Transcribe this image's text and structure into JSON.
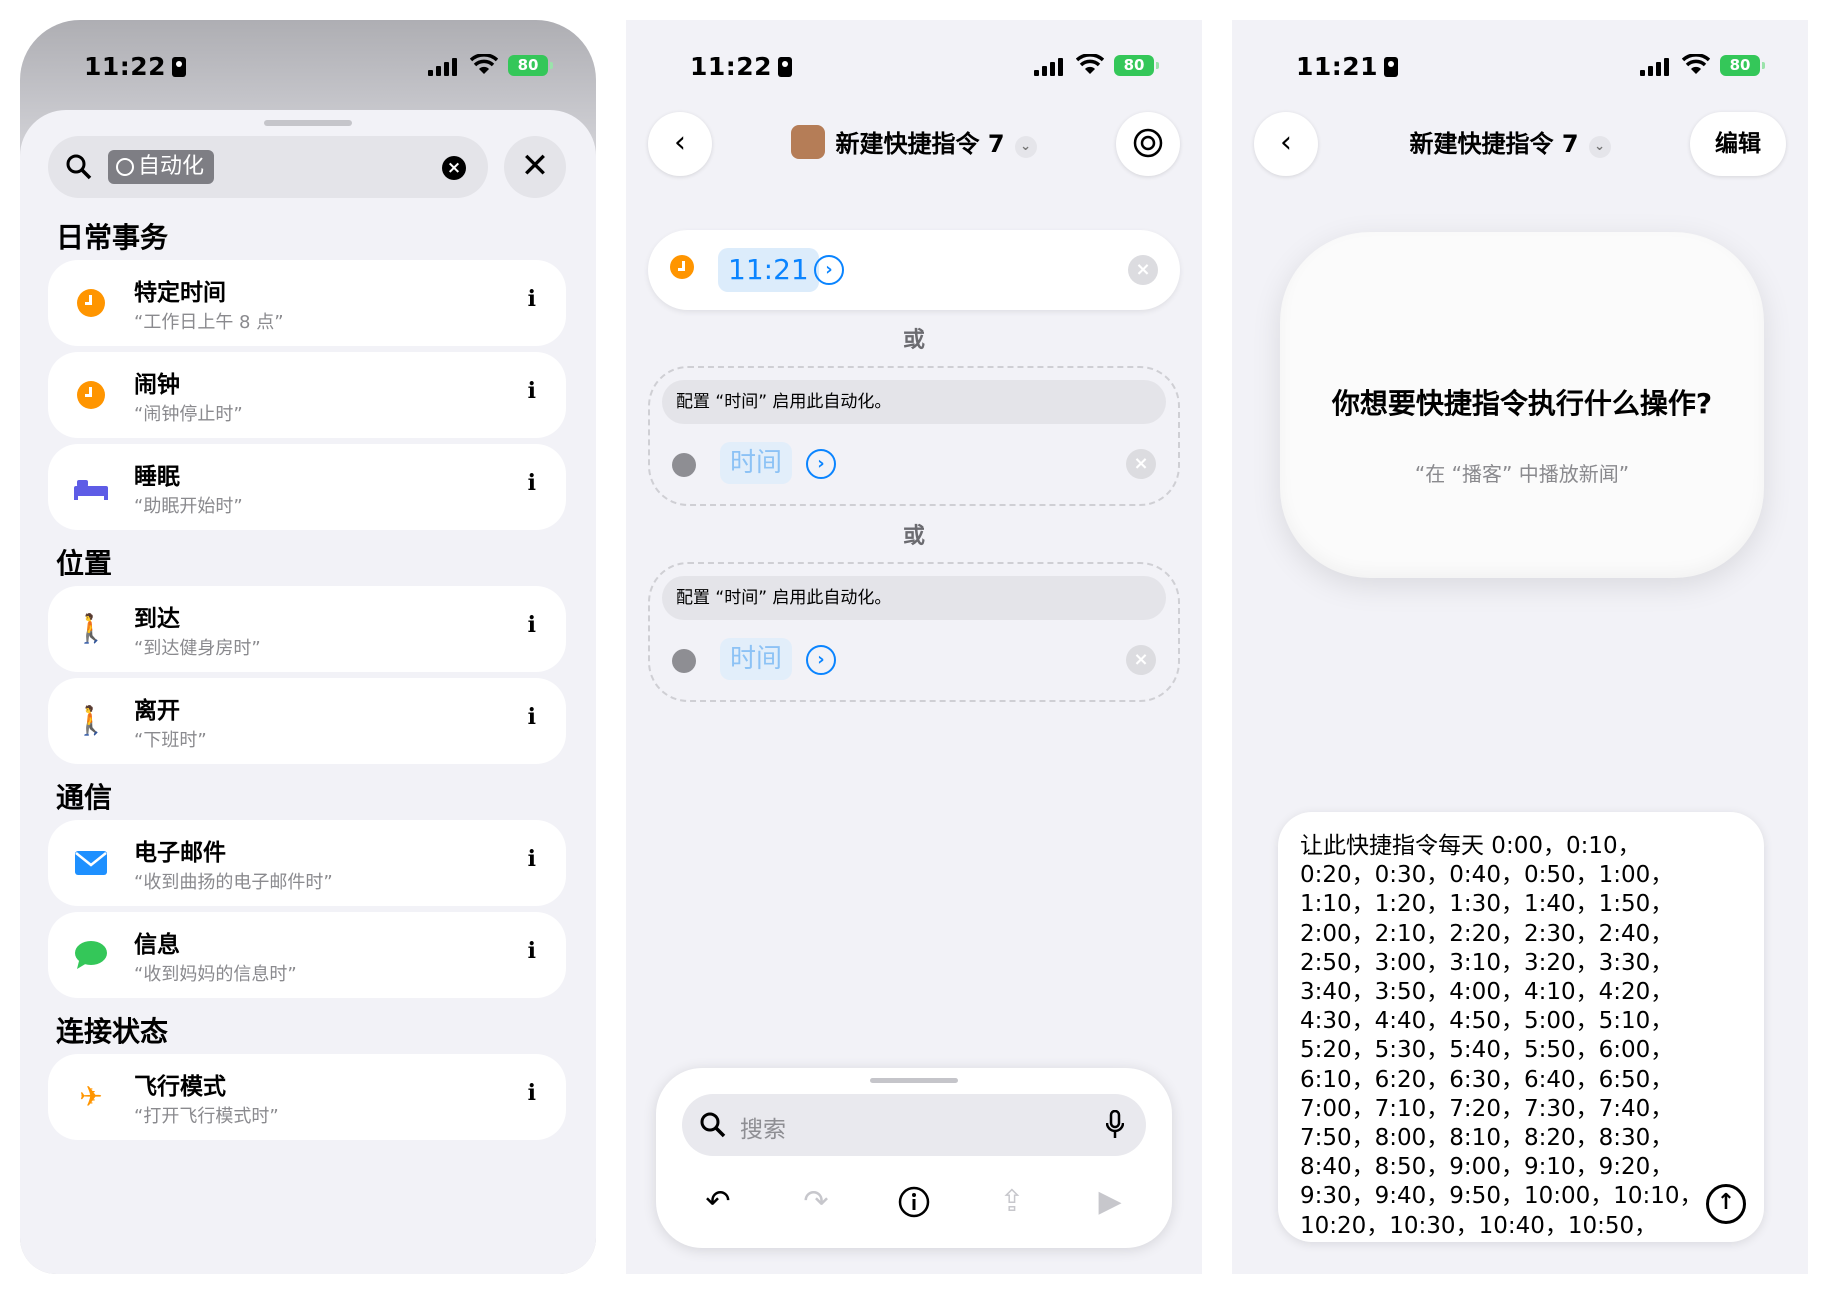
{
  "status": {
    "time_left": "11:22",
    "time_mid": "11:22",
    "time_right": "11:21",
    "battery": "80"
  },
  "panel1": {
    "search_token": "自动化",
    "sections": [
      {
        "title": "日常事务"
      },
      {
        "title": "位置"
      },
      {
        "title": "通信"
      },
      {
        "title": "连接状态"
      }
    ],
    "items": [
      {
        "title": "特定时间",
        "sub": "“工作日上午 8 点”",
        "icon": "clock-icon"
      },
      {
        "title": "闹钟",
        "sub": "“闹钟停止时”",
        "icon": "alarm-icon"
      },
      {
        "title": "睡眠",
        "sub": "“助眠开始时”",
        "icon": "bed-icon"
      },
      {
        "title": "到达",
        "sub": "“到达健身房时”",
        "icon": "arrive-icon"
      },
      {
        "title": "离开",
        "sub": "“下班时”",
        "icon": "leave-icon"
      },
      {
        "title": "电子邮件",
        "sub": "“收到曲扬的电子邮件时”",
        "icon": "mail-icon"
      },
      {
        "title": "信息",
        "sub": "“收到妈妈的信息时”",
        "icon": "message-icon"
      },
      {
        "title": "飞行模式",
        "sub": "“打开飞行模式时”",
        "icon": "airplane-icon"
      }
    ],
    "info_glyph": "i"
  },
  "panel2": {
    "title": "新建快捷指令 7",
    "time_value": "11:21",
    "or_label": "或",
    "hint": "配置 “时间” 启用此自动化。",
    "placeholder_value": "时间",
    "search_placeholder": "搜索"
  },
  "panel3": {
    "title": "新建快捷指令 7",
    "edit_label": "编辑",
    "question": "你想要快捷指令执行什么操作?",
    "example": "“在 “播客” 中播放新闻”",
    "input_text": "让此快捷指令每天 0:00，0:10，\n0:20，0:30，0:40，0:50，1:00，\n1:10，1:20，1:30，1:40，1:50，\n2:00，2:10，2:20，2:30，2:40，\n2:50，3:00，3:10，3:20，3:30，\n3:40，3:50，4:00，4:10，4:20，\n4:30，4:40，4:50，5:00，5:10，\n5:20，5:30，5:40，5:50，6:00，\n6:10，6:20，6:30，6:40，6:50，\n7:00，7:10，7:20，7:30，7:40，\n7:50，8:00，8:10，8:20，8:30，\n8:40，8:50，9:00，9:10，9:20，\n9:30，9:40，9:50，10:00，10:10，\n10:20，10:30，10:40，10:50，"
  },
  "colors": {
    "accent": "#0a84ff",
    "orange": "#ff9500",
    "green": "#34c759"
  }
}
